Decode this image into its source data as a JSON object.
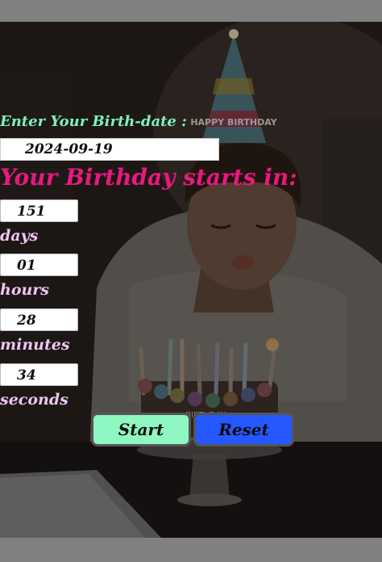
{
  "form": {
    "birthdate_label": "Enter Your Birth-date :",
    "birthdate_value": "2024-09-19",
    "heading": "Your Birthday starts in:"
  },
  "countdown": {
    "days": {
      "value": "151",
      "label": "days"
    },
    "hours": {
      "value": "01",
      "label": "hours"
    },
    "minutes": {
      "value": "28",
      "label": "minutes"
    },
    "seconds": {
      "value": "34",
      "label": "seconds"
    }
  },
  "buttons": {
    "start_label": "Start",
    "reset_label": "Reset"
  },
  "colors": {
    "label_green": "#7ef2b9",
    "heading_pink": "#e8197e",
    "unit_lilac": "#f0c3f4",
    "start_bg": "#8ef7c2",
    "reset_bg": "#2558ff"
  },
  "background": {
    "hat_text": "HAPPY BIRTHDAY",
    "cake_text": "BIRTHDAY"
  }
}
